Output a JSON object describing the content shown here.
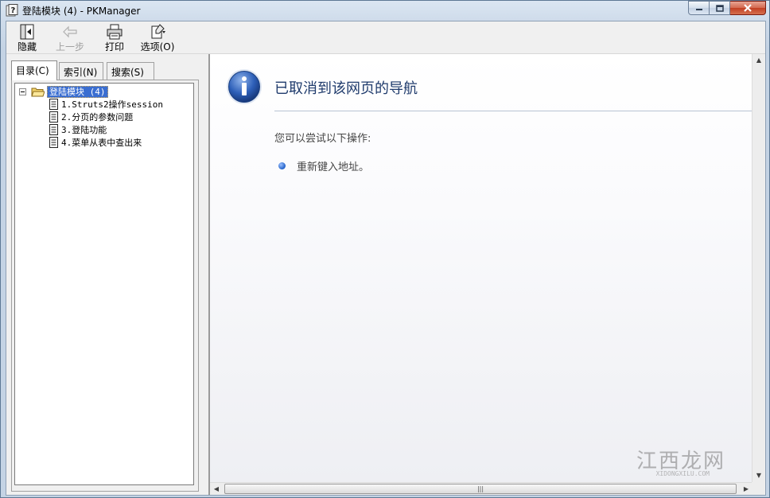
{
  "window": {
    "title": "登陆模块 (4) - PKManager",
    "controls": {
      "minimize_icon": "minimize-icon",
      "maximize_icon": "maximize-icon",
      "close_icon": "close-icon"
    }
  },
  "toolbar": {
    "hide_label": "隐藏",
    "back_label": "上一步",
    "print_label": "打印",
    "options_label": "选项(O)"
  },
  "nav": {
    "tabs": [
      {
        "label": "目录(C)",
        "active": true
      },
      {
        "label": "索引(N)",
        "active": false
      },
      {
        "label": "搜索(S)",
        "active": false
      }
    ],
    "tree": {
      "root_label": "登陆模块 (4)",
      "items": [
        {
          "label": "1.Struts2操作session"
        },
        {
          "label": "2.分页的参数问题"
        },
        {
          "label": "3.登陆功能"
        },
        {
          "label": "4.菜单从表中查出来"
        }
      ]
    }
  },
  "content": {
    "heading": "已取消到该网页的导航",
    "try_text": "您可以尝试以下操作:",
    "bullets": [
      "重新键入地址。"
    ],
    "icon": "info-icon"
  },
  "watermark": {
    "text": "江西龙网",
    "sub": "XIDONGXILU.COM"
  },
  "colors": {
    "accent": "#1f3b6c",
    "selection": "#3a6ed1",
    "close_button": "#c23f22"
  }
}
